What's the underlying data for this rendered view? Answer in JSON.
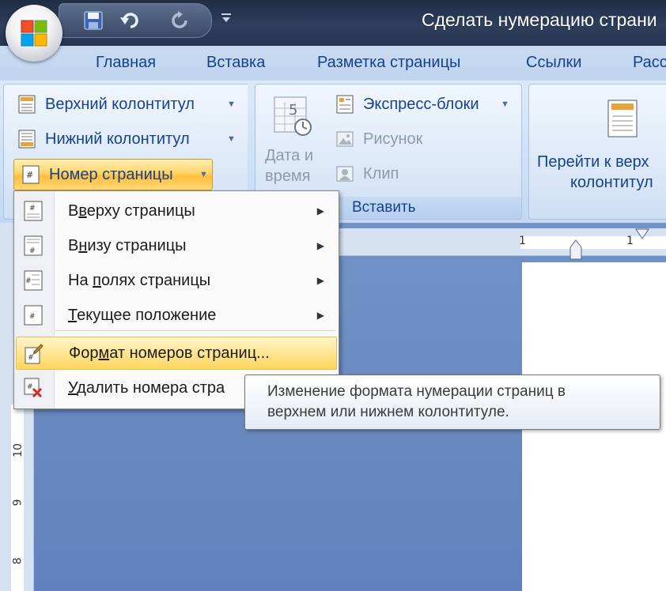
{
  "window": {
    "title": "Сделать нумерацию страни"
  },
  "tabs": [
    "Главная",
    "Вставка",
    "Разметка страницы",
    "Ссылки",
    "Расс"
  ],
  "ribbon": {
    "header_footer": {
      "header": "Верхний колонтитул",
      "footer": "Нижний колонтитул",
      "page_number": "Номер страницы"
    },
    "insert": {
      "date_line1": "Дата и",
      "date_line2": "время",
      "quick_parts": "Экспресс-блоки",
      "picture": "Рисунок",
      "clip": "Клип",
      "group_label": "Вставить"
    },
    "navigation": {
      "goto_line1": "Перейти к верх",
      "goto_line2": "колонтитул"
    }
  },
  "menu": {
    "items": [
      {
        "pre": "В",
        "u": "в",
        "post": "ерху страницы",
        "submenu": true
      },
      {
        "pre": "В",
        "u": "н",
        "post": "изу страницы",
        "submenu": true
      },
      {
        "pre": "На ",
        "u": "п",
        "post": "олях страницы",
        "submenu": true
      },
      {
        "pre": "",
        "u": "Т",
        "post": "екущее положение",
        "submenu": true
      },
      {
        "pre": "Фор",
        "u": "м",
        "post": "ат номеров страниц...",
        "submenu": false
      },
      {
        "pre": "",
        "u": "У",
        "post": "далить номера стра",
        "submenu": false
      }
    ],
    "highlighted_index": 4
  },
  "tooltip": {
    "line1": "Изменение формата нумерации страниц в",
    "line2": "верхнем или нижнем колонтитуле."
  },
  "rulers": {
    "horizontal_marks": [
      "1",
      "1"
    ],
    "vertical_marks": [
      "10",
      "9",
      "8"
    ]
  },
  "colors": {
    "accent_highlight": "#ffd466",
    "ribbon_text": "#15428b",
    "document_bg": "#6987bf"
  },
  "icons": {
    "office_button": "office-logo-icon",
    "save": "save-icon",
    "undo": "undo-icon",
    "redo": "redo-icon"
  }
}
